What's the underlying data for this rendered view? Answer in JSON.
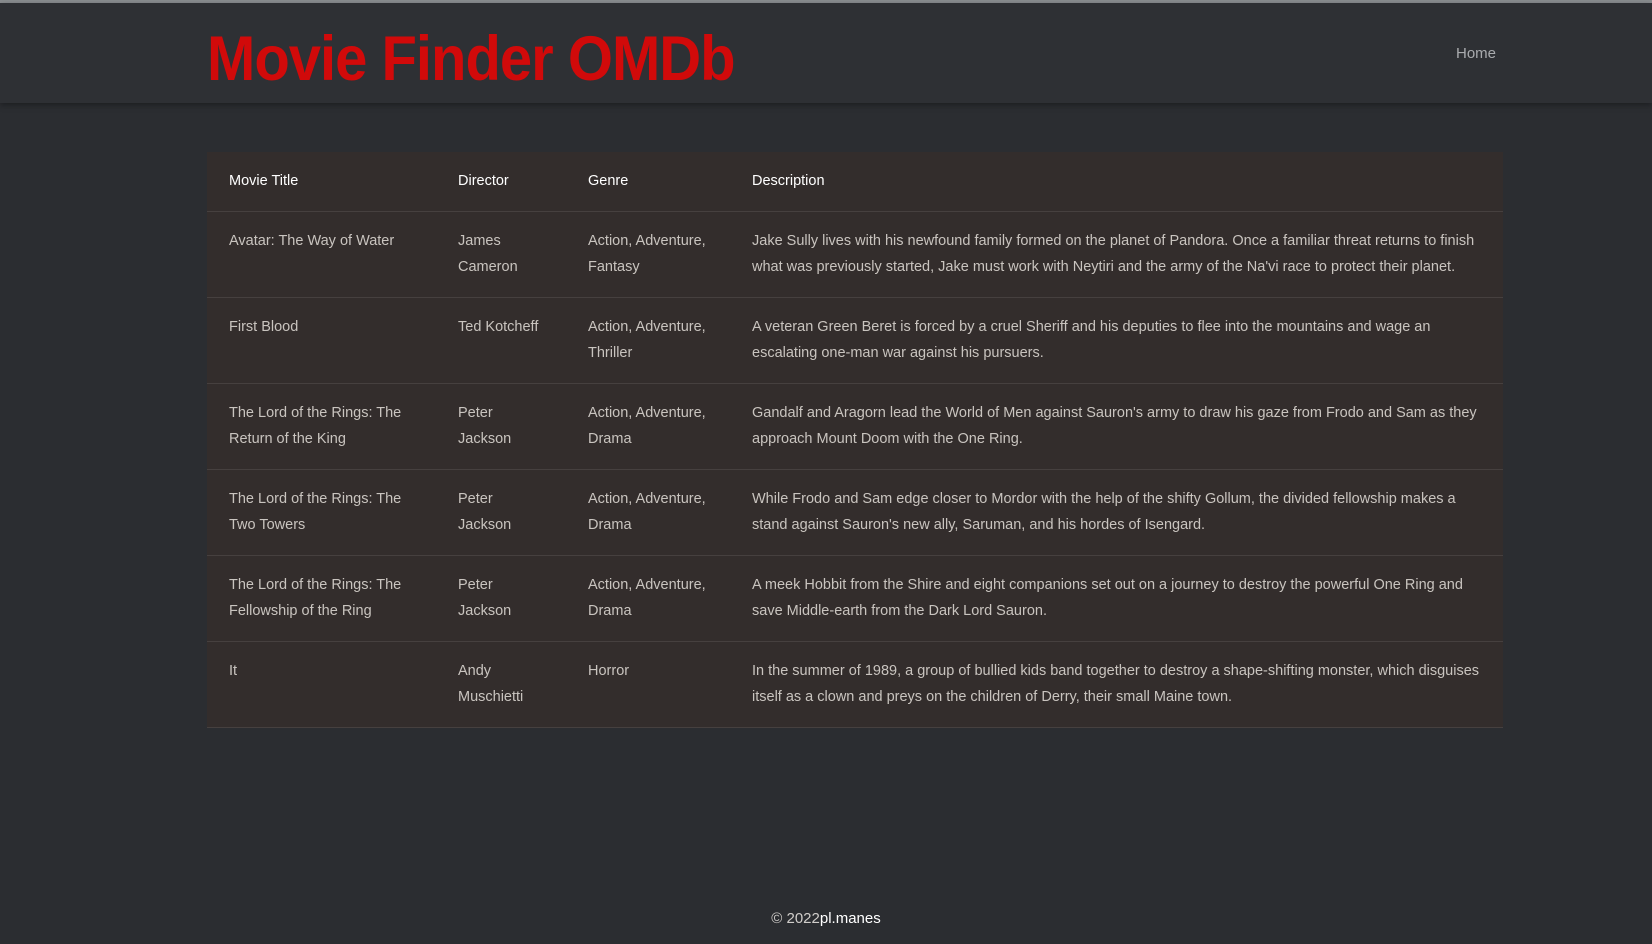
{
  "header": {
    "brand": "Movie Finder OMDb",
    "nav": {
      "home": "Home"
    }
  },
  "table": {
    "columns": [
      "Movie Title",
      "Director",
      "Genre",
      "Description"
    ],
    "rows": [
      {
        "title": "Avatar: The Way of Water",
        "director": "James Cameron",
        "genre": "Action, Adventure, Fantasy",
        "description": "Jake Sully lives with his newfound family formed on the planet of Pandora. Once a familiar threat returns to finish what was previously started, Jake must work with Neytiri and the army of the Na'vi race to protect their planet."
      },
      {
        "title": "First Blood",
        "director": "Ted Kotcheff",
        "genre": "Action, Adventure, Thriller",
        "description": "A veteran Green Beret is forced by a cruel Sheriff and his deputies to flee into the mountains and wage an escalating one-man war against his pursuers."
      },
      {
        "title": "The Lord of the Rings: The Return of the King",
        "director": "Peter Jackson",
        "genre": "Action, Adventure, Drama",
        "description": "Gandalf and Aragorn lead the World of Men against Sauron's army to draw his gaze from Frodo and Sam as they approach Mount Doom with the One Ring."
      },
      {
        "title": "The Lord of the Rings: The Two Towers",
        "director": "Peter Jackson",
        "genre": "Action, Adventure, Drama",
        "description": "While Frodo and Sam edge closer to Mordor with the help of the shifty Gollum, the divided fellowship makes a stand against Sauron's new ally, Saruman, and his hordes of Isengard."
      },
      {
        "title": "The Lord of the Rings: The Fellowship of the Ring",
        "director": "Peter Jackson",
        "genre": "Action, Adventure, Drama",
        "description": "A meek Hobbit from the Shire and eight companions set out on a journey to destroy the powerful One Ring and save Middle-earth from the Dark Lord Sauron."
      },
      {
        "title": "It",
        "director": "Andy Muschietti",
        "genre": "Horror",
        "description": "In the summer of 1989, a group of bullied kids band together to destroy a shape-shifting monster, which disguises itself as a clown and preys on the children of Derry, their small Maine town."
      }
    ]
  },
  "footer": {
    "copyright": "© 2022",
    "author": "pl.manes"
  },
  "colors": {
    "brand": "#d10a0a",
    "background": "#2b2d31",
    "table_background": "#332d2c"
  }
}
